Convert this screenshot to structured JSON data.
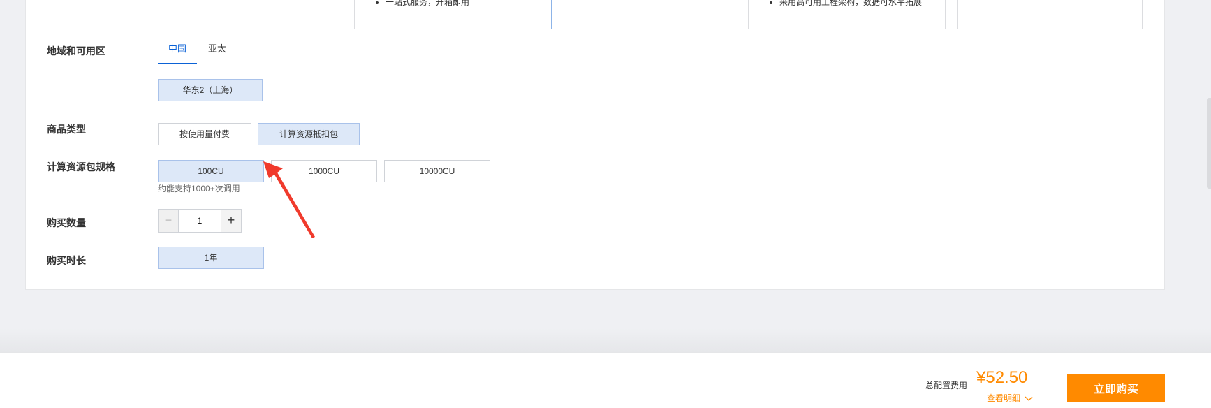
{
  "cards": [
    {
      "text": ""
    },
    {
      "text": "一站式服务，开箱即用"
    },
    {
      "text": ""
    },
    {
      "text": "采用高可用工程架构，数据可水平拓展"
    },
    {
      "text": ""
    }
  ],
  "region": {
    "label": "地域和可用区",
    "tabs": [
      "中国",
      "亚太"
    ],
    "active_tab": "中国",
    "option": "华东2（上海）"
  },
  "product_type": {
    "label": "商品类型",
    "options": [
      "按使用量付费",
      "计算资源抵扣包"
    ],
    "selected": "计算资源抵扣包"
  },
  "package_spec": {
    "label": "计算资源包规格",
    "options": [
      "100CU",
      "1000CU",
      "10000CU"
    ],
    "selected": "100CU",
    "hint": "约能支持1000+次调用"
  },
  "quantity": {
    "label": "购买数量",
    "value": "1",
    "minus": "−",
    "plus": "+"
  },
  "duration": {
    "label": "购买时长",
    "option": "1年"
  },
  "footer": {
    "cost_label": "总配置费用",
    "price": "¥52.50",
    "details_link": "查看明细",
    "buy_button": "立即购买"
  },
  "colors": {
    "accent": "#0b62d6",
    "orange": "#ff8a00",
    "selected_bg": "#dde8f8",
    "arrow": "#f03a2c"
  }
}
